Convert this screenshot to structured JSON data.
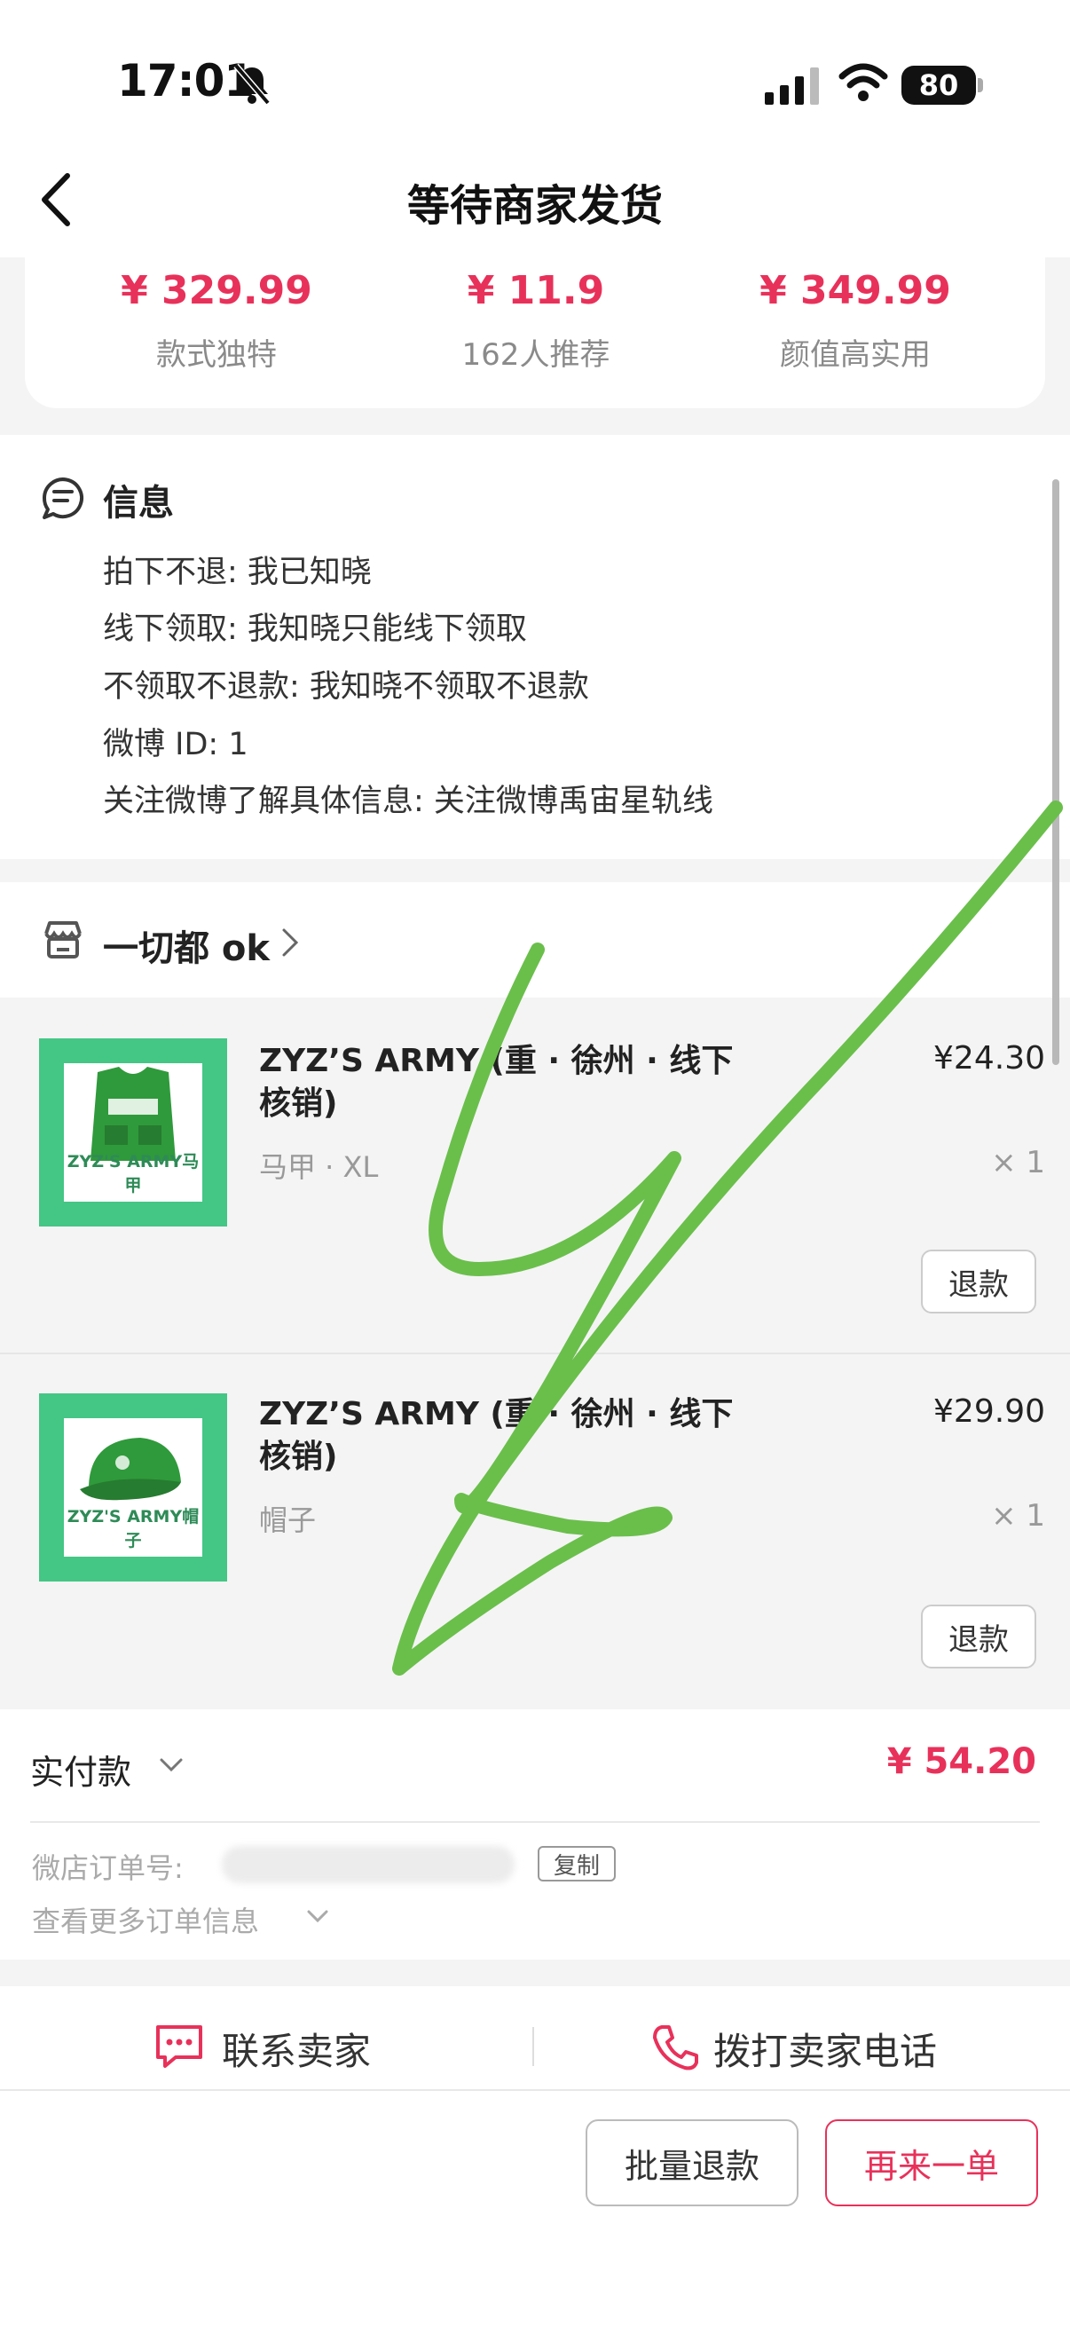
{
  "status_bar": {
    "time": "17:01",
    "battery": "80"
  },
  "nav": {
    "title": "等待商家发货"
  },
  "recommendations": [
    {
      "price": "¥ 329.99",
      "caption": "款式独特"
    },
    {
      "price": "¥ 11.9",
      "caption": "162人推荐"
    },
    {
      "price": "¥ 349.99",
      "caption": "颜值高实用"
    }
  ],
  "info": {
    "title": "信息",
    "lines": [
      "拍下不退: 我已知晓",
      "线下领取: 我知晓只能线下领取",
      "不领取不退款: 我知晓不领取不退款",
      "微博 ID: 1",
      "关注微博了解具体信息: 关注微博禹宙星轨线"
    ]
  },
  "shop": {
    "name": "一切都 ok"
  },
  "products": [
    {
      "title": "ZYZ’S ARMY (重 · 徐州 · 线下核销)",
      "spec": "马甲 · XL",
      "price": "¥24.30",
      "qty": "× 1",
      "refund": "退款",
      "thumb_caption": "ZYZ'S ARMY马甲"
    },
    {
      "title": "ZYZ’S ARMY (重 · 徐州 · 线下核销)",
      "spec": "帽子",
      "price": "¥29.90",
      "qty": "× 1",
      "refund": "退款",
      "thumb_caption": "ZYZ'S ARMY帽子"
    }
  ],
  "payment": {
    "label": "实付款",
    "amount": "¥ 54.20",
    "order_label": "微店订单号:",
    "copy": "复制",
    "more": "查看更多订单信息"
  },
  "actions": {
    "contact_seller": "联系卖家",
    "call_seller": "拨打卖家电话",
    "bulk_refund": "批量退款",
    "order_again": "再来一单"
  },
  "colors": {
    "accent": "#e8315a",
    "thumb_green": "#44c685",
    "signature_green": "#6abf4b"
  }
}
